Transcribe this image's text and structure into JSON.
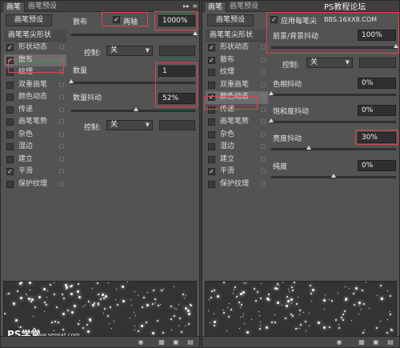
{
  "tabs": {
    "brush": "画笔",
    "brush_presets": "画笔预设"
  },
  "tab_controls": {
    "collapse": "▸▸",
    "menu": "≡"
  },
  "preset_button": "画笔预设",
  "sidebar": {
    "title": "画笔笔尖形状",
    "items": [
      {
        "label": "形状动态",
        "checked": true
      },
      {
        "label": "散布",
        "checked": true
      },
      {
        "label": "纹理",
        "checked": false
      },
      {
        "label": "双重画笔",
        "checked": false
      },
      {
        "label": "颜色动态",
        "checked": false
      },
      {
        "label": "传递",
        "checked": false
      },
      {
        "label": "画笔笔势",
        "checked": false
      },
      {
        "label": "杂色",
        "checked": false
      },
      {
        "label": "湿边",
        "checked": false
      },
      {
        "label": "建立",
        "checked": false
      },
      {
        "label": "平滑",
        "checked": true
      },
      {
        "label": "保护纹理",
        "checked": false
      }
    ],
    "check_mark": "✓",
    "lock_glyph": "🔒"
  },
  "scatter_panel": {
    "scatter_label": "散布",
    "both_axes_label": "两轴",
    "both_axes_checked": true,
    "scatter_value": "1000%",
    "control_label": "控制:",
    "control_value": "关",
    "count_label": "数量",
    "count_value": "1",
    "count_jitter_label": "数量抖动",
    "count_jitter_value": "52%",
    "control2_label": "控制:",
    "control2_value": "关"
  },
  "color_panel": {
    "apply_per_tip_label": "应用每笔尖",
    "apply_per_tip_checked": true,
    "fg_bg_jitter_label": "前景/背景抖动",
    "fg_bg_jitter_value": "100%",
    "control_label": "控制:",
    "control_value": "关",
    "hue_jitter_label": "色相抖动",
    "hue_jitter_value": "0%",
    "saturation_jitter_label": "饱和度抖动",
    "saturation_jitter_value": "0%",
    "brightness_jitter_label": "亮度抖动",
    "brightness_jitter_value": "30%",
    "purity_label": "纯度",
    "purity_value": "0%"
  },
  "right_sidebar_selected": "颜色动态",
  "watermarks": {
    "site_top": "PS教程论坛",
    "site_url": "BBS.16XX8.COM",
    "bottom_left": "PS学堂",
    "bottom_url": "www.sepsxt.com"
  },
  "colors": {
    "panel": "#535353",
    "highlight_box": "#e0474c",
    "field_bg": "#2f2f2f"
  },
  "levels": {
    "scatter": 1.0,
    "count": 0.0,
    "count_jitter": 0.52,
    "fg_bg_jitter": 1.0,
    "hue_jitter": 0.0,
    "saturation_jitter": 0.0,
    "brightness_jitter": 0.3,
    "purity": 0.5
  }
}
